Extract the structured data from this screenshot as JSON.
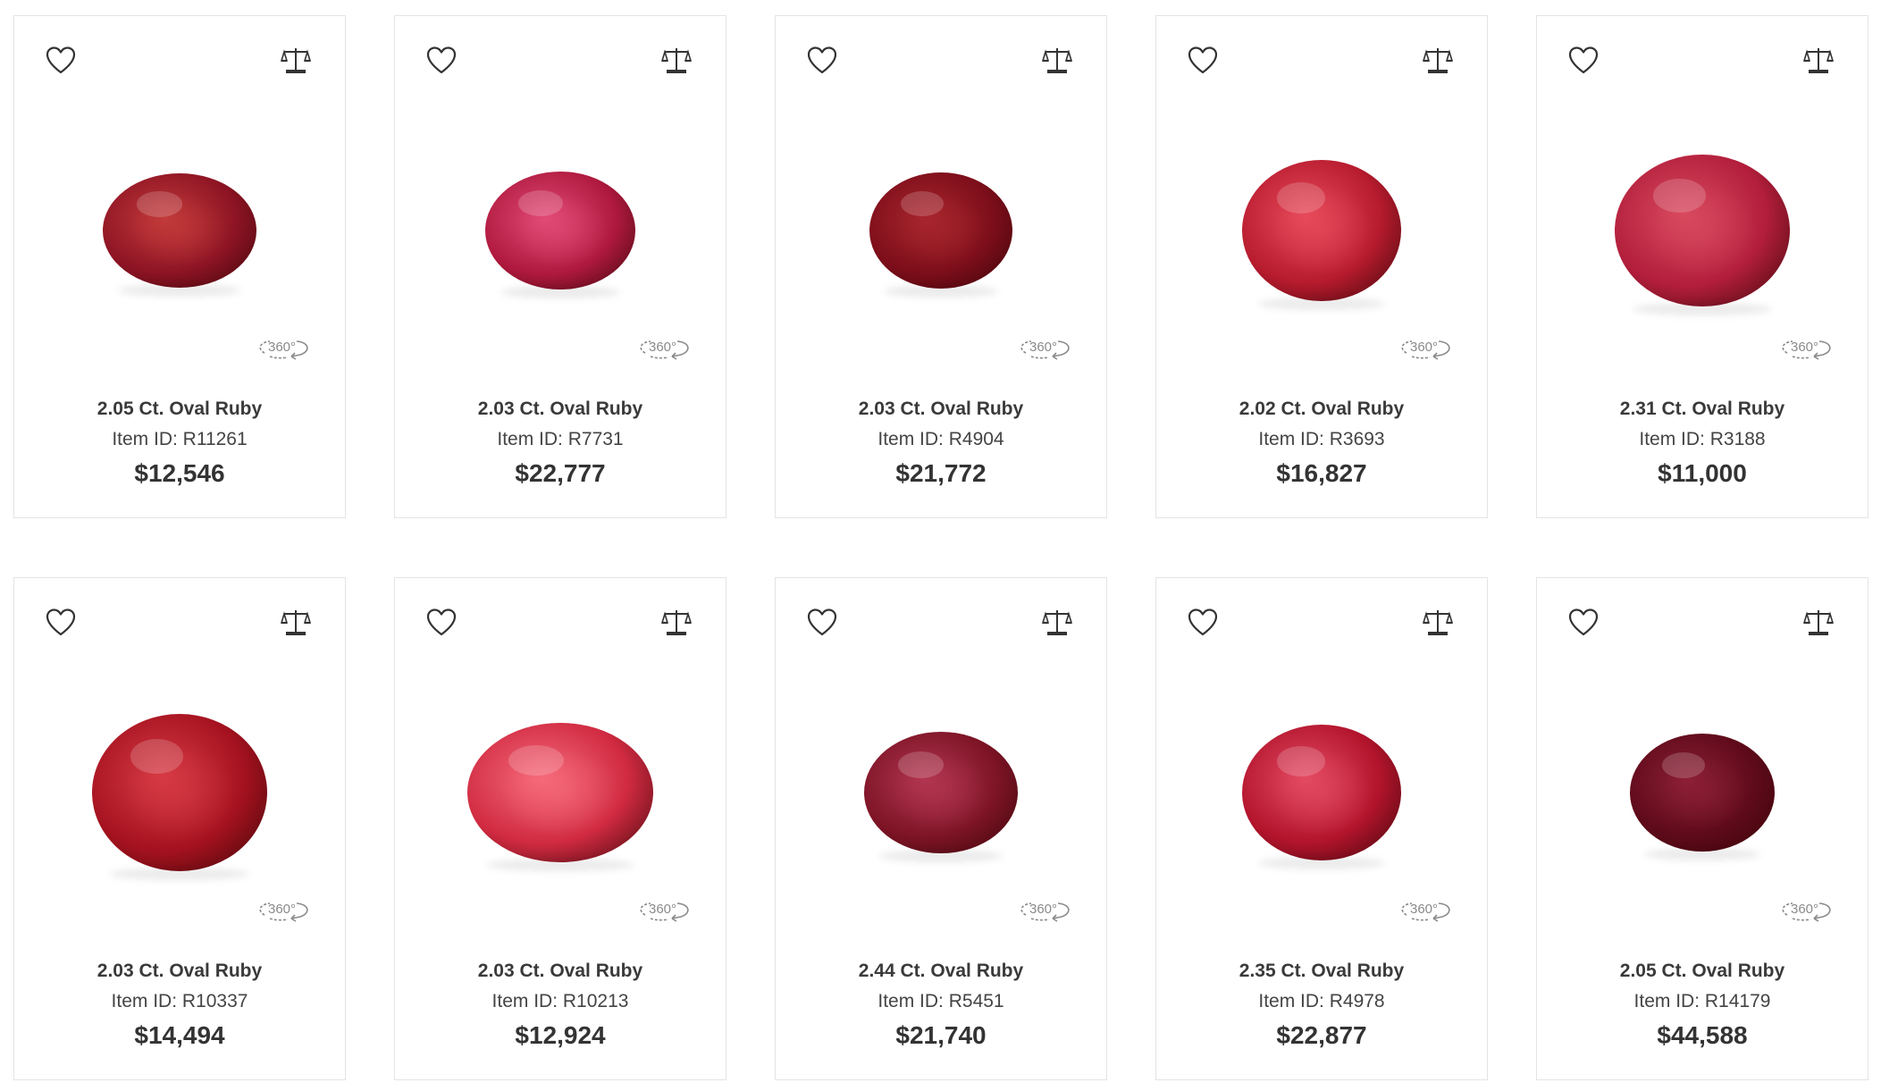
{
  "labels": {
    "item_id_prefix": "Item ID: ",
    "rotate_360": "360°"
  },
  "products": [
    {
      "title": "2.05 Ct. Oval Ruby",
      "item_id": "Item ID: R11261",
      "price": "$12,546",
      "color": "#8e1424",
      "highlight": "#c23a3a"
    },
    {
      "title": "2.03 Ct. Oval Ruby",
      "item_id": "Item ID: R7731",
      "price": "$22,777",
      "color": "#b0193f",
      "highlight": "#e04a74"
    },
    {
      "title": "2.03 Ct. Oval Ruby",
      "item_id": "Item ID: R4904",
      "price": "$21,772",
      "color": "#7c0e1a",
      "highlight": "#a8252d"
    },
    {
      "title": "2.02 Ct. Oval Ruby",
      "item_id": "Item ID: R3693",
      "price": "$16,827",
      "color": "#b71b2e",
      "highlight": "#e74a5a"
    },
    {
      "title": "2.31 Ct. Oval Ruby",
      "item_id": "Item ID: R3188",
      "price": "$11,000",
      "color": "#b21e3b",
      "highlight": "#d8495e"
    },
    {
      "title": "2.03 Ct. Oval Ruby",
      "item_id": "Item ID: R10337",
      "price": "$14,494",
      "color": "#a5121f",
      "highlight": "#d63a44"
    },
    {
      "title": "2.03 Ct. Oval Ruby",
      "item_id": "Item ID: R10213",
      "price": "$12,924",
      "color": "#d02a41",
      "highlight": "#f56a7a"
    },
    {
      "title": "2.44 Ct. Oval Ruby",
      "item_id": "Item ID: R5451",
      "price": "$21,740",
      "color": "#7d1426",
      "highlight": "#b23550"
    },
    {
      "title": "2.35 Ct. Oval Ruby",
      "item_id": "Item ID: R4978",
      "price": "$22,877",
      "color": "#b2142c",
      "highlight": "#e34a62"
    },
    {
      "title": "2.05 Ct. Oval Ruby",
      "item_id": "Item ID: R14179",
      "price": "$44,588",
      "color": "#5e0a1a",
      "highlight": "#8c1f35"
    }
  ],
  "icons": {
    "wishlist": "heart-icon",
    "compare": "scale-compare-icon",
    "rotate": "360-view-icon"
  },
  "colors": {
    "card_border": "#e4e4e4",
    "text": "#333333",
    "icon": "#333333",
    "icon_360": "#8a8a8a"
  }
}
